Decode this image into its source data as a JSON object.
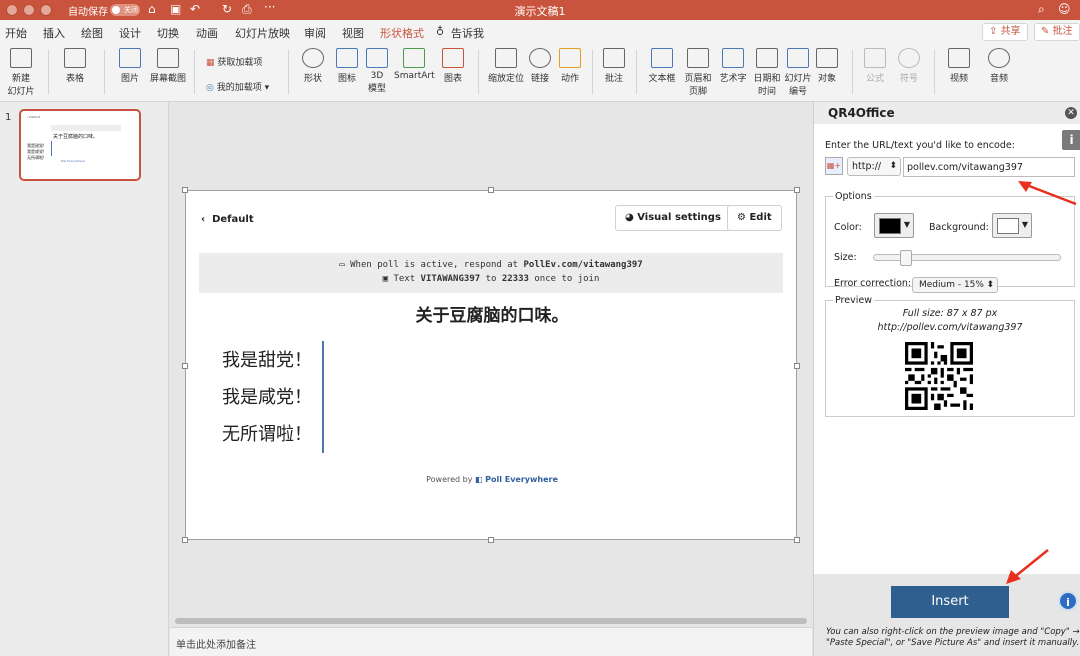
{
  "titlebar": {
    "autosave_label": "自动保存",
    "autosave_state": "关闭",
    "doc_title": "演示文稿1",
    "more": "···"
  },
  "tabs": [
    {
      "label": "开始"
    },
    {
      "label": "插入"
    },
    {
      "label": "绘图"
    },
    {
      "label": "设计"
    },
    {
      "label": "切换"
    },
    {
      "label": "动画"
    },
    {
      "label": "幻灯片放映"
    },
    {
      "label": "审阅"
    },
    {
      "label": "视图"
    },
    {
      "label": "形状格式"
    },
    {
      "label": "告诉我"
    }
  ],
  "tab_actions": {
    "share": "共享",
    "comment": "批注"
  },
  "ribbon": {
    "new_slide": "新建\n幻灯片",
    "table": "表格",
    "picture": "图片",
    "screenshot": "屏幕截图",
    "get_addins": "获取加载项",
    "my_addins": "我的加载项",
    "shapes": "形状",
    "icons": "图标",
    "model3d": "3D\n模型",
    "smartart": "SmartArt",
    "chart": "图表",
    "zoom": "缩放定位",
    "link": "链接",
    "action": "动作",
    "comment": "批注",
    "textbox": "文本框",
    "header_footer": "页眉和\n页脚",
    "wordart": "艺术字",
    "datetime": "日期和\n时间",
    "slide_number": "幻灯片\n编号",
    "object": "对象",
    "equation": "公式",
    "symbol": "符号",
    "video": "视频",
    "audio": "音频"
  },
  "thumbnails": {
    "slide_number": "1"
  },
  "slide": {
    "back_label": "Default",
    "visual_settings": "Visual settings",
    "edit": "Edit",
    "respond_line1_prefix": "When poll is active, respond at ",
    "respond_line1_url": "PollEv.com/vitawang397",
    "respond_line2_prefix": "Text ",
    "respond_line2_code": "VITAWANG397",
    "respond_line2_mid": " to ",
    "respond_line2_number": "22333",
    "respond_line2_suffix": " once to join",
    "poll_title": "关于豆腐脑的口味。",
    "options": [
      "我是甜党！",
      "我是咸党！",
      "无所谓啦！"
    ],
    "powered_prefix": "Powered by ",
    "powered_brand": "Poll Everywhere"
  },
  "notes_placeholder": "单击此处添加备注",
  "pane": {
    "title": "QR4Office",
    "info": "i",
    "enter_label": "Enter the URL/text you'd like to encode:",
    "protocol": "http://",
    "url_value": "pollev.com/vitawang397",
    "options_legend": "Options",
    "color_label": "Color:",
    "background_label": "Background:",
    "size_label": "Size:",
    "size_fraction": 0.15,
    "error_label": "Error correction:",
    "error_value": "Medium - 15%",
    "preview_legend": "Preview",
    "full_size": "Full size: 87 x 87 px",
    "preview_url": "http://pollev.com/vitawang397",
    "insert": "Insert",
    "tip": "You can also right-click on the preview image and \"Copy\" → \"Paste Special\", or \"Save Picture As\" and insert it manually."
  },
  "colors": {
    "brand": "#c8543d",
    "insert_button": "#2e5f8e",
    "qr_color": "#000000",
    "qr_background": "#ffffff",
    "poll_accent": "#4a78b5",
    "arrow": "#e8301c"
  }
}
